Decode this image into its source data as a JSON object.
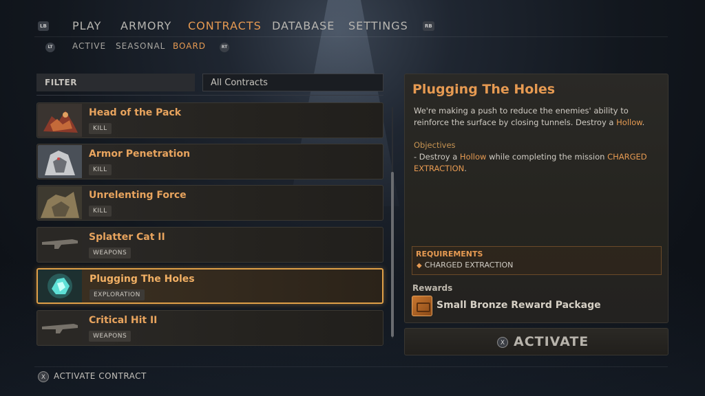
{
  "nav": {
    "left_hint": "LB",
    "right_hint": "RB",
    "items": [
      {
        "label": "PLAY"
      },
      {
        "label": "ARMORY"
      },
      {
        "label": "CONTRACTS"
      },
      {
        "label": "DATABASE"
      },
      {
        "label": "SETTINGS"
      }
    ],
    "active_index": 2
  },
  "subnav": {
    "left_hint": "LT",
    "right_hint": "RT",
    "items": [
      {
        "label": "ACTIVE"
      },
      {
        "label": "SEASONAL"
      },
      {
        "label": "BOARD"
      }
    ],
    "active_index": 2
  },
  "filter": {
    "label": "FILTER",
    "value": "All Contracts"
  },
  "contracts": [
    {
      "title": "Head of the Pack",
      "tag": "KILL",
      "icon": "creature-thumbnail"
    },
    {
      "title": "Armor Penetration",
      "tag": "KILL",
      "icon": "creature-thumbnail"
    },
    {
      "title": "Unrelenting Force",
      "tag": "KILL",
      "icon": "creature-thumbnail"
    },
    {
      "title": "Splatter Cat II",
      "tag": "WEAPONS",
      "icon": "rifle-thumbnail"
    },
    {
      "title": "Plugging The Holes",
      "tag": "EXPLORATION",
      "icon": "crystal-thumbnail"
    },
    {
      "title": "Critical Hit II",
      "tag": "WEAPONS",
      "icon": "rifle-thumbnail"
    }
  ],
  "selected_index": 4,
  "details": {
    "title": "Plugging The Holes",
    "desc_part1": "We're making a push to reduce the enemies' ability to reinforce the surface by closing tunnels. Destroy a ",
    "desc_hl": "Hollow",
    "desc_part2": ".",
    "objectives_header": "Objectives",
    "obj_part1": "- Destroy a ",
    "obj_hl1": "Hollow",
    "obj_part2": " while completing the mission ",
    "obj_hl2": "CHARGED EXTRACTION",
    "obj_part3": ".",
    "requirements_header": "REQUIREMENTS",
    "requirement": "CHARGED EXTRACTION",
    "rewards_header": "Rewards",
    "reward": "Small Bronze Reward Package"
  },
  "activate": {
    "button_glyph": "X",
    "label": "ACTIVATE"
  },
  "footer": {
    "button_glyph": "X",
    "hint": "ACTIVATE CONTRACT"
  },
  "colors": {
    "accent": "#e69a52",
    "selected_border": "#e0a048"
  }
}
